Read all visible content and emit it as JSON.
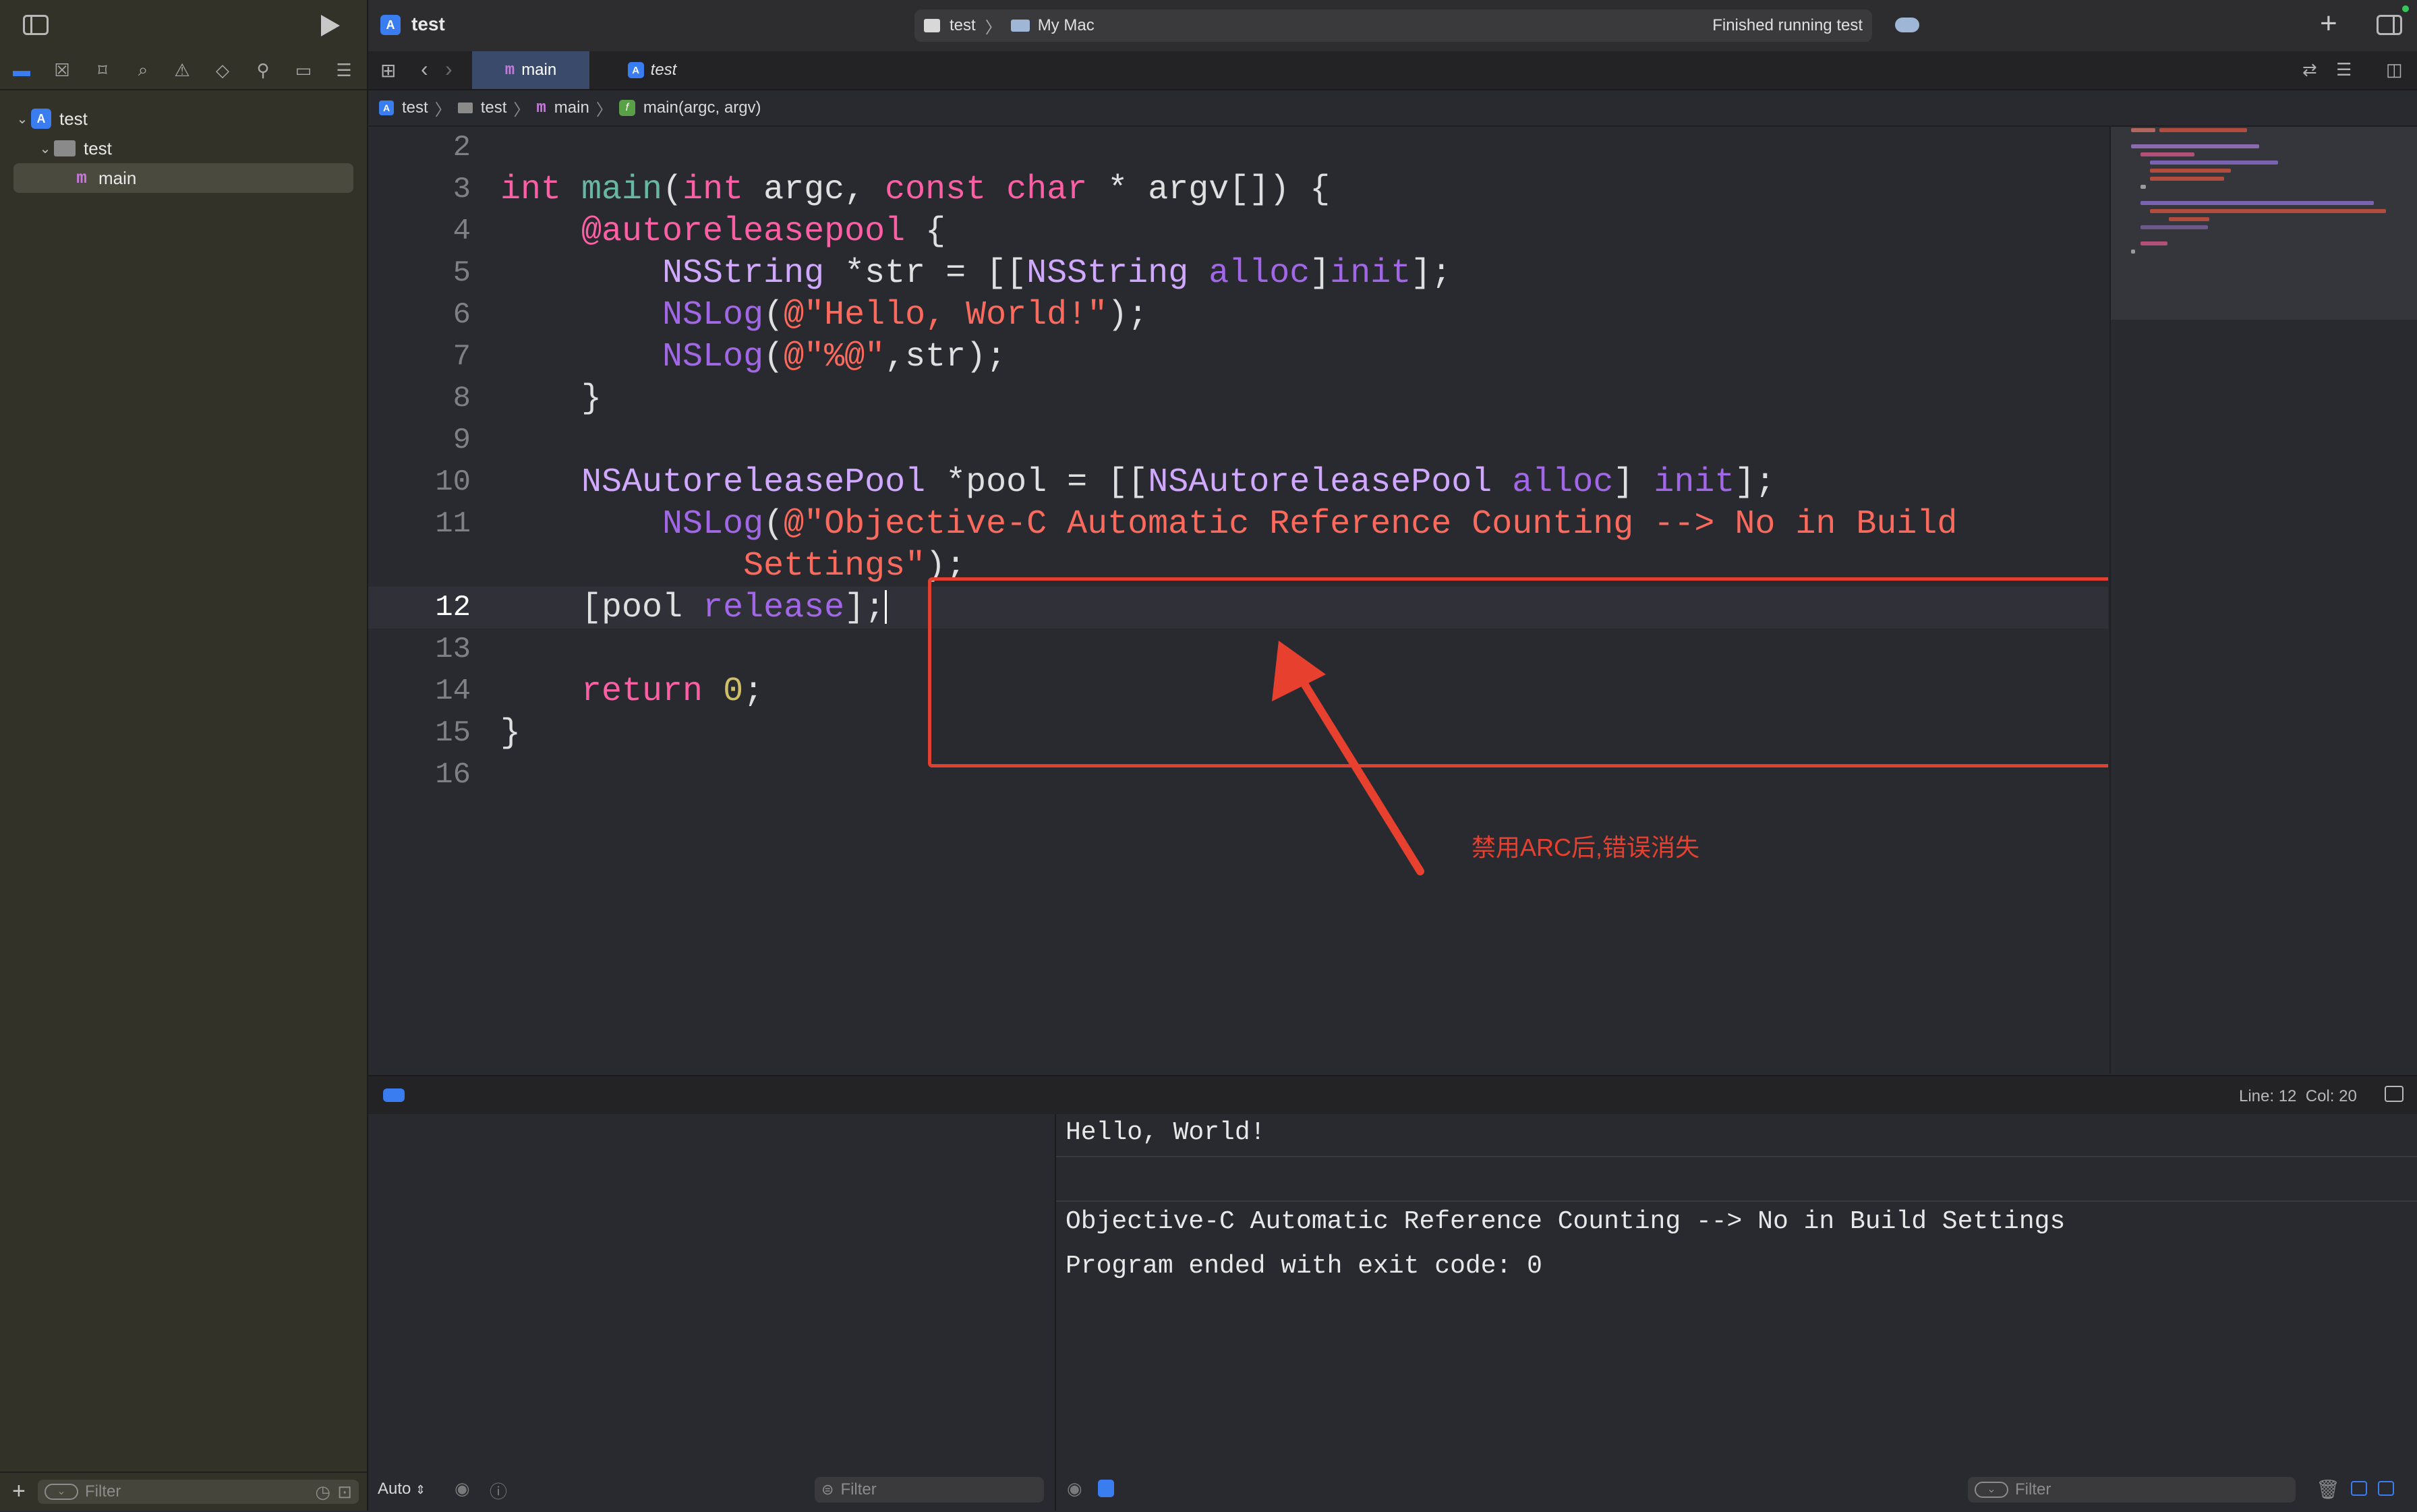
{
  "window": {
    "project_title": "test",
    "scheme": "test",
    "destination": "My Mac",
    "status": "Finished running test"
  },
  "navigator": {
    "items": [
      {
        "label": "test",
        "kind": "project"
      },
      {
        "label": "test",
        "kind": "folder"
      },
      {
        "label": "main",
        "kind": "file"
      }
    ],
    "filter_placeholder": "Filter"
  },
  "tabs": [
    {
      "label": "main",
      "active": true
    },
    {
      "label": "test",
      "active": false
    }
  ],
  "jumpbar": {
    "crumbs": [
      "test",
      "test",
      "main",
      "main(argc, argv)"
    ]
  },
  "editor": {
    "lines": [
      {
        "n": "2"
      },
      {
        "n": "3"
      },
      {
        "n": "4"
      },
      {
        "n": "5"
      },
      {
        "n": "6"
      },
      {
        "n": "7"
      },
      {
        "n": "8"
      },
      {
        "n": "9"
      },
      {
        "n": "10"
      },
      {
        "n": "11"
      },
      {
        "n": ""
      },
      {
        "n": "12"
      },
      {
        "n": "13"
      },
      {
        "n": "14"
      },
      {
        "n": "15"
      },
      {
        "n": "16"
      }
    ],
    "annotation": "禁用ARC后,错误消失",
    "cursor_position": "Line: 12  Col: 20"
  },
  "console": {
    "lines": [
      "Hello, World!",
      "",
      "Objective-C Automatic Reference Counting --> No in Build Settings",
      "Program ended with exit code: 0"
    ],
    "filter_placeholder": "Filter"
  },
  "variables": {
    "scope": "Auto",
    "filter_placeholder": "Filter"
  },
  "colors": {
    "accent": "#3a7df0",
    "highlight_border": "#e0402f"
  }
}
